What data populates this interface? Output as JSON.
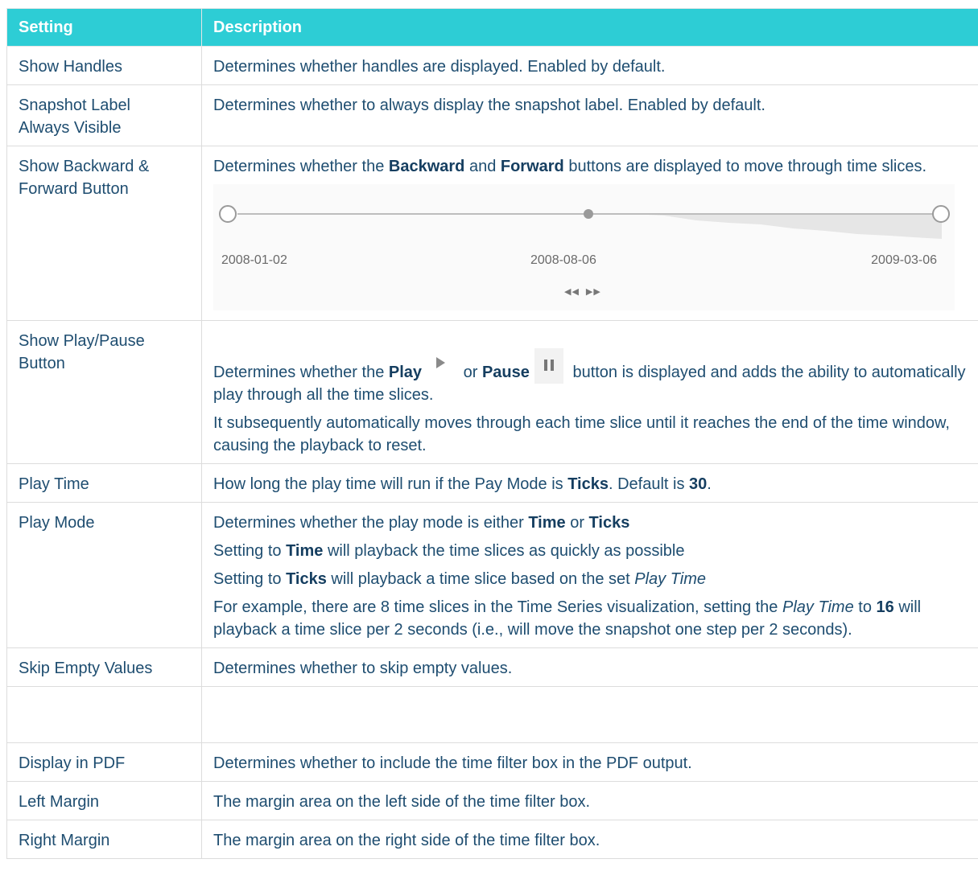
{
  "table": {
    "headers": {
      "setting": "Setting",
      "description": "Description"
    },
    "rows": {
      "show_handles": {
        "setting": "Show Handles",
        "desc": "Determines whether handles are displayed. Enabled by default."
      },
      "snapshot_label": {
        "setting_line1": "Snapshot Label",
        "setting_line2": "Always Visible",
        "desc": "Determines whether to always display the snapshot label. Enabled by default."
      },
      "backward_forward": {
        "setting_line1": "Show Backward &",
        "setting_line2": "Forward Button",
        "desc_prefix": "Determines whether the ",
        "desc_bold1": "Backward",
        "desc_mid": " and ",
        "desc_bold2": "Forward",
        "desc_suffix": " buttons are displayed to move through time slices.",
        "timeline": {
          "start_label": "2008-01-02",
          "mid_label": "2008-08-06",
          "end_label": "2009-03-06",
          "back_icon": "◀◀",
          "forward_icon": "▶▶"
        }
      },
      "play_pause": {
        "setting_line1": "Show Play/Pause",
        "setting_line2": "Button",
        "p1_prefix": "Determines whether the ",
        "p1_bold1": "Play",
        "p1_mid": " or ",
        "p1_bold2": "Pause",
        "p1_suffix": " button is displayed and adds the ability to automatically play through all the time slices.",
        "p2": "It subsequently automatically moves through each time slice until it reaches the end of the time window, causing the playback to reset."
      },
      "play_time": {
        "setting": "Play Time",
        "desc_prefix": "How long the play time will run if the Pay Mode is ",
        "desc_bold1": "Ticks",
        "desc_mid": ". Default is ",
        "desc_bold2": "30",
        "desc_suffix": "."
      },
      "play_mode": {
        "setting": "Play Mode",
        "p1_prefix": "Determines whether the play mode is either ",
        "p1_bold1": "Time",
        "p1_mid": " or ",
        "p1_bold2": "Ticks",
        "p2_prefix": "Setting to ",
        "p2_bold": "Time",
        "p2_suffix": " will playback the time slices as quickly as possible",
        "p3_prefix": "Setting to ",
        "p3_bold": "Ticks",
        "p3_suffix": " will playback a time slice based on the set ",
        "p3_italic": "Play Time",
        "p4_prefix": "For example, there are 8 time slices in the Time Series visualization, setting the ",
        "p4_italic": "Play Time",
        "p4_mid": " to ",
        "p4_bold": "16",
        "p4_suffix": " will playback a time slice per 2 seconds (i.e., will move the snapshot one step per 2 seconds)."
      },
      "skip_empty": {
        "setting": "Skip Empty Values",
        "desc": "Determines whether to skip empty values."
      },
      "display_pdf": {
        "setting": "Display in PDF",
        "desc": "Determines whether to include the time filter box in the PDF output."
      },
      "left_margin": {
        "setting": "Left Margin",
        "desc": "The margin area on the left side of the time filter box."
      },
      "right_margin": {
        "setting": "Right Margin",
        "desc": "The margin area on the right side of the time filter box."
      }
    }
  }
}
